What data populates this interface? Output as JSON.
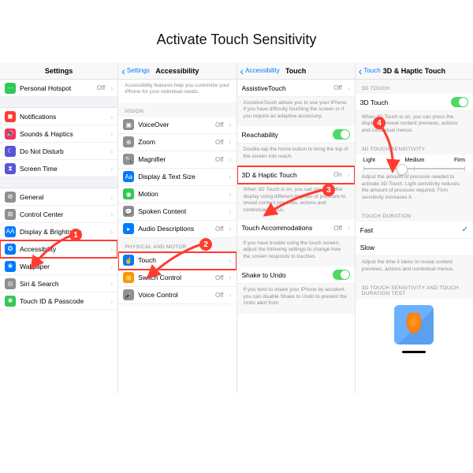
{
  "title": "Activate Touch Sensitivity",
  "callouts": [
    "1",
    "2",
    "3",
    "4"
  ],
  "panel1": {
    "header": "Settings",
    "rows_a": [
      {
        "icon": "i-green",
        "glyph": "⋯",
        "label": "Personal Hotspot",
        "val": "Off"
      }
    ],
    "rows_b": [
      {
        "icon": "i-red",
        "glyph": "◼",
        "label": "Notifications"
      },
      {
        "icon": "i-pink",
        "glyph": "🔊",
        "label": "Sounds & Haptics"
      },
      {
        "icon": "i-purple",
        "glyph": "☾",
        "label": "Do Not Disturb"
      },
      {
        "icon": "i-purple",
        "glyph": "⧗",
        "label": "Screen Time"
      }
    ],
    "rows_c": [
      {
        "icon": "i-gray",
        "glyph": "⚙",
        "label": "General"
      },
      {
        "icon": "i-gray",
        "glyph": "⊞",
        "label": "Control Center"
      },
      {
        "icon": "i-blue",
        "glyph": "AA",
        "label": "Display & Brightness"
      },
      {
        "icon": "i-blue",
        "glyph": "✪",
        "label": "Accessibility",
        "highlight": true
      },
      {
        "icon": "i-blue",
        "glyph": "❀",
        "label": "Wallpaper"
      },
      {
        "icon": "i-gray",
        "glyph": "◎",
        "label": "Siri & Search"
      },
      {
        "icon": "i-green",
        "glyph": "✱",
        "label": "Touch ID & Passcode"
      }
    ]
  },
  "panel2": {
    "back": "Settings",
    "header": "Accessibility",
    "intro": "Accessibility features help you customize your iPhone for your individual needs.",
    "sec_vision": "VISION",
    "vision_rows": [
      {
        "icon": "i-gray",
        "glyph": "▣",
        "label": "VoiceOver",
        "val": "Off"
      },
      {
        "icon": "i-gray",
        "glyph": "⊕",
        "label": "Zoom",
        "val": "Off"
      },
      {
        "icon": "i-gray",
        "glyph": "🔍",
        "label": "Magnifier",
        "val": "Off"
      },
      {
        "icon": "i-blue",
        "glyph": "Aa",
        "label": "Display & Text Size"
      },
      {
        "icon": "i-green",
        "glyph": "◉",
        "label": "Motion"
      },
      {
        "icon": "i-gray",
        "glyph": "💬",
        "label": "Spoken Content"
      },
      {
        "icon": "i-blue",
        "glyph": "▸",
        "label": "Audio Descriptions",
        "val": "Off"
      }
    ],
    "sec_motor": "PHYSICAL AND MOTOR",
    "motor_rows": [
      {
        "icon": "i-blue",
        "glyph": "☝",
        "label": "Touch",
        "highlight": true
      },
      {
        "icon": "i-orange",
        "glyph": "⊞",
        "label": "Switch Control",
        "val": "Off"
      },
      {
        "icon": "i-gray",
        "glyph": "🎤",
        "label": "Voice Control",
        "val": "Off"
      }
    ]
  },
  "panel3": {
    "back": "Accessibility",
    "header": "Touch",
    "rows": [
      {
        "label": "AssistiveTouch",
        "val": "Off",
        "chev": true
      },
      {
        "desc": "AssistiveTouch allows you to use your iPhone if you have difficulty touching the screen or if you require an adaptive accessory."
      },
      {
        "label": "Reachability",
        "toggle": "on"
      },
      {
        "desc": "Double-tap the home button to bring the top of the screen into reach."
      },
      {
        "label": "3D & Haptic Touch",
        "val": "On",
        "chev": true,
        "highlight": true
      },
      {
        "desc": "When 3D Touch is on, you can press on the display using different degrees of pressure to reveal content previews, actions and contextual menus."
      },
      {
        "label": "Touch Accommodations",
        "val": "Off",
        "chev": true
      },
      {
        "desc": "If you have trouble using the touch screen, adjust the following settings to change how the screen responds to touches."
      },
      {
        "label": "Shake to Undo",
        "toggle": "on"
      },
      {
        "desc": "If you tend to shake your iPhone by accident, you can disable Shake to Undo to prevent the Undo alert from"
      }
    ]
  },
  "panel4": {
    "back": "Touch",
    "header": "3D & Haptic Touch",
    "sec_3d": "3D TOUCH",
    "row_3d": {
      "label": "3D Touch",
      "toggle": "on"
    },
    "desc_3d": "When 3D Touch is on, you can press the display to reveal content previews, actions and contextual menus.",
    "sec_sens": "3D TOUCH SENSITIVITY",
    "sens_labels": [
      "Light",
      "Medium",
      "Firm"
    ],
    "desc_sens": "Adjust the amount of pressure needed to activate 3D Touch. Light sensitivity reduces the amount of pressure required. Firm sensitivity increases it.",
    "sec_dur": "TOUCH DURATION",
    "dur_rows": [
      {
        "label": "Fast",
        "check": true
      },
      {
        "label": "Slow"
      }
    ],
    "desc_dur": "Adjust the time it takes to reveal content previews, actions and contextual menus.",
    "sec_test": "3D TOUCH SENSITIVITY AND TOUCH DURATION TEST"
  }
}
